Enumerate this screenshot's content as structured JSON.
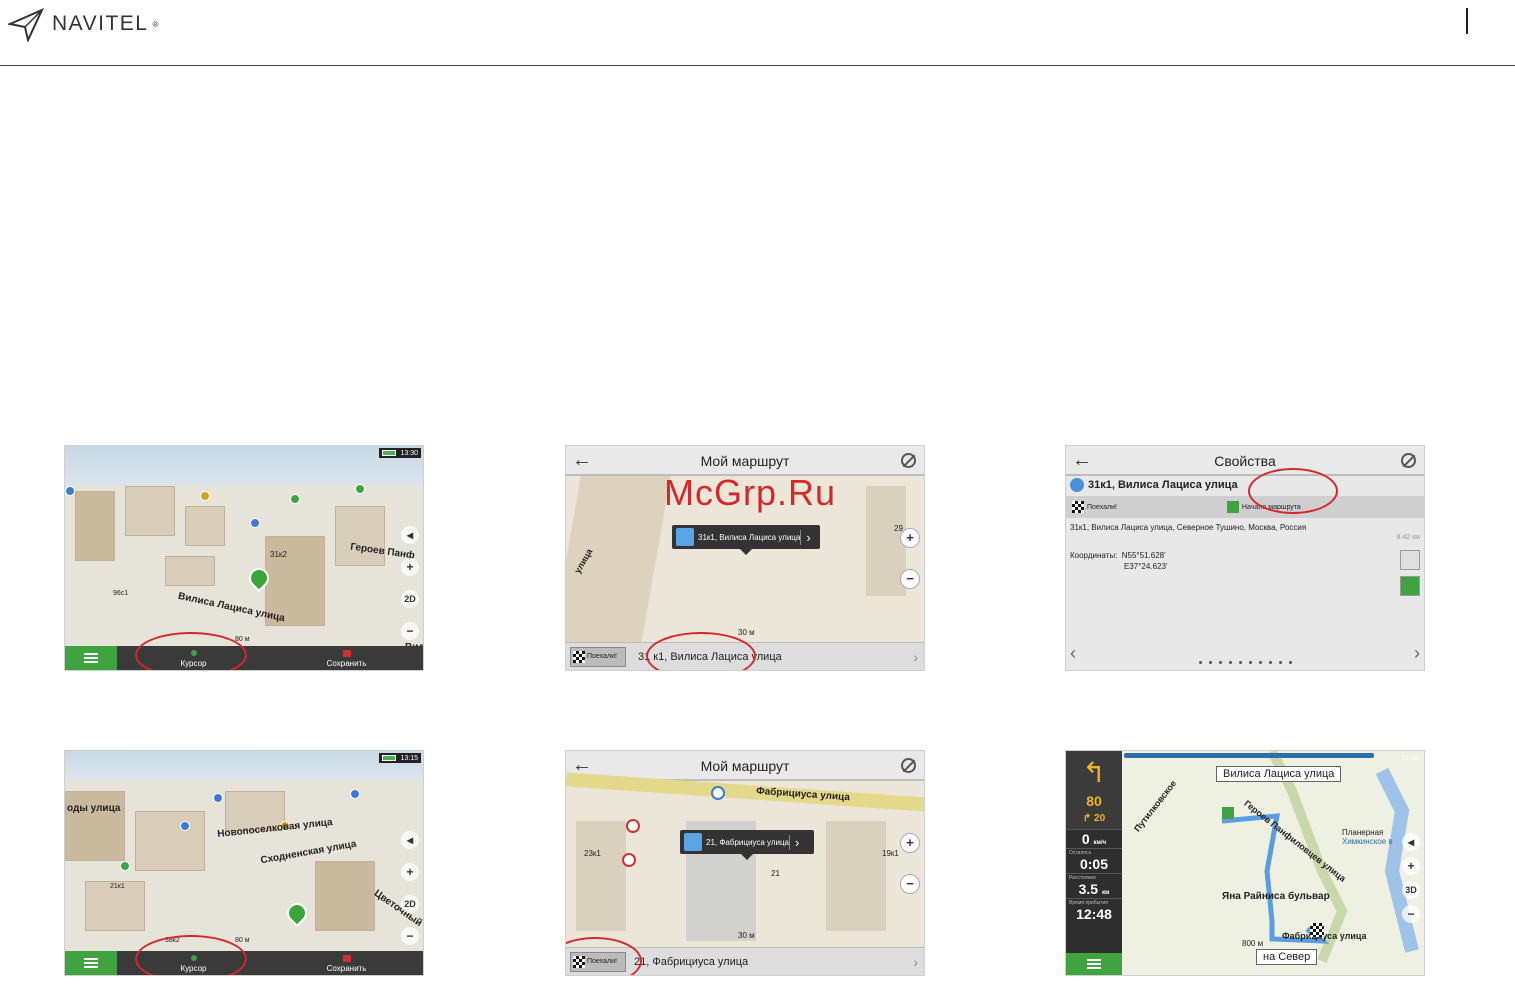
{
  "header": {
    "brand": "NAVITEL",
    "reg": "®"
  },
  "watermark": "McGrp.Ru",
  "screen1": {
    "time": "13:30",
    "streets": [
      "Героев Панф",
      "Вилиса Лациса улица",
      "31к2",
      "96с1"
    ],
    "scale": "80 м",
    "cursor_label": "Курсор",
    "save_label": "Сохранить",
    "ctrl_2d": "2D",
    "vil": "Вил"
  },
  "screen2": {
    "title": "Мой маршрут",
    "bubble": "31к1, Вилиса Лациса улица",
    "go_label": "Поехали!",
    "address": "31 к1, Вилиса Лациса улица",
    "scale": "30 м",
    "street_side": "улица",
    "num": "29"
  },
  "screen3": {
    "title": "Свойства",
    "name": "31к1, Вилиса Лациса улица",
    "go_label": "Поехали!",
    "start_label": "Начало маршрута",
    "address": "31к1, Вилиса Лациса улица, Северное Тушино, Москва, Россия",
    "distance": "8.42 км",
    "coords_label": "Координаты:",
    "lat": "N55°51.628'",
    "lon": "E37°24.623'"
  },
  "screen4": {
    "time": "13:15",
    "streets": [
      "оды улица",
      "Новопоселковая улица",
      "Сходненская улица",
      "Цветочный",
      "21к1",
      "38к2"
    ],
    "scale": "80 м",
    "cursor_label": "Курсор",
    "save_label": "Сохранить",
    "ctrl_2d": "2D"
  },
  "screen5": {
    "title": "Мой маршрут",
    "street_top": "Фабрициуса улица",
    "bubble": "21, Фабрициуса улица",
    "go_label": "Поехали!",
    "address": "21, Фабрициуса улица",
    "scale": "30 м",
    "labels": [
      "23к1",
      "19к1",
      "21"
    ]
  },
  "screen6": {
    "time": "12:43",
    "street_top": "Вилиса Лациса улица",
    "speed": "80",
    "next_dist": "20",
    "cur_speed": "0",
    "speed_unit": "км/ч",
    "lbl_left": "Осталось",
    "time_left": "0:05",
    "lbl_dist": "Расстояние",
    "dist": "3.5",
    "dist_unit": "км",
    "lbl_arrival": "Время прибытия",
    "arrival": "12:48",
    "map_labels": [
      "Путилковское",
      "Героев Панфиловцев улица",
      "Яна Райниса бульвар",
      "Фабрициуса улица",
      "Планерная",
      "Химкинское в"
    ],
    "scale": "800 м",
    "north_btn": "на Север",
    "ctrl_3d": "3D"
  }
}
